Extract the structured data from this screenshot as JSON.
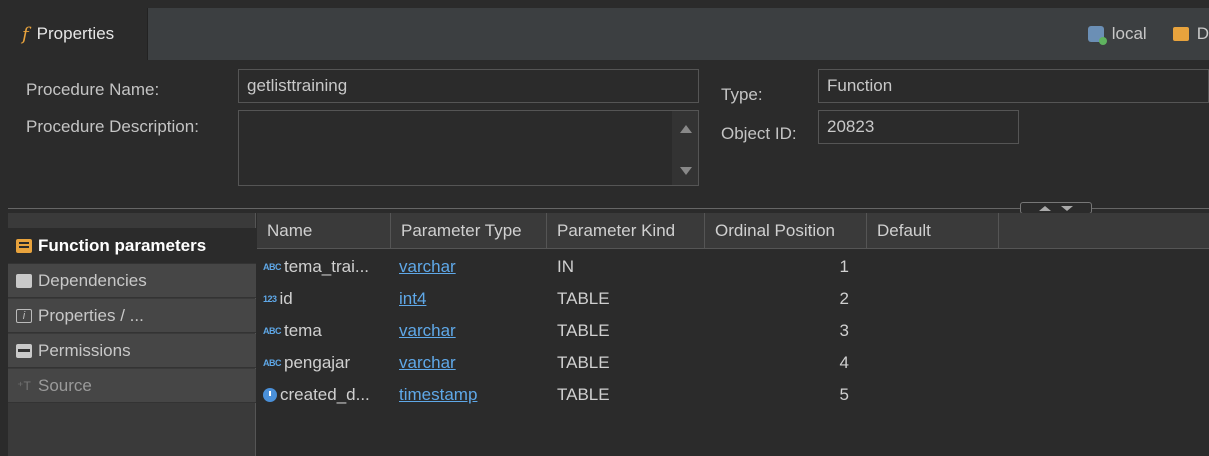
{
  "tab": {
    "title": "Properties",
    "fx_glyph": "f"
  },
  "connection": {
    "name": "local",
    "db_label": "D"
  },
  "form": {
    "procedure_name_label": "Procedure Name:",
    "procedure_name_value": "getlisttraining",
    "procedure_desc_label": "Procedure Description:",
    "procedure_desc_value": "",
    "type_label": "Type:",
    "type_value": "Function",
    "object_id_label": "Object ID:",
    "object_id_value": "20823"
  },
  "nav": {
    "items": [
      {
        "label": "Function parameters",
        "icon": "function-params-icon",
        "active": true
      },
      {
        "label": "Dependencies",
        "icon": "folder-icon"
      },
      {
        "label": "Properties / ...",
        "icon": "info-icon"
      },
      {
        "label": "Permissions",
        "icon": "key-icon"
      },
      {
        "label": "Source",
        "icon": "source-icon",
        "disabled": true
      }
    ]
  },
  "table": {
    "columns": [
      "Name",
      "Parameter Type",
      "Parameter Kind",
      "Ordinal Position",
      "Default"
    ],
    "rows": [
      {
        "icon": "ABC",
        "name": "tema_trai...",
        "type": "varchar",
        "kind": "IN",
        "ordinal": "1",
        "default": ""
      },
      {
        "icon": "123",
        "name": "id",
        "type": "int4",
        "kind": "TABLE",
        "ordinal": "2",
        "default": ""
      },
      {
        "icon": "ABC",
        "name": "tema",
        "type": "varchar",
        "kind": "TABLE",
        "ordinal": "3",
        "default": ""
      },
      {
        "icon": "ABC",
        "name": "pengajar",
        "type": "varchar",
        "kind": "TABLE",
        "ordinal": "4",
        "default": ""
      },
      {
        "icon": "clock",
        "name": "created_d...",
        "type": "timestamp",
        "kind": "TABLE",
        "ordinal": "5",
        "default": ""
      }
    ]
  },
  "colors": {
    "link": "#5fa8e8",
    "accent": "#e8a33d",
    "bg": "#2b2b2b"
  }
}
